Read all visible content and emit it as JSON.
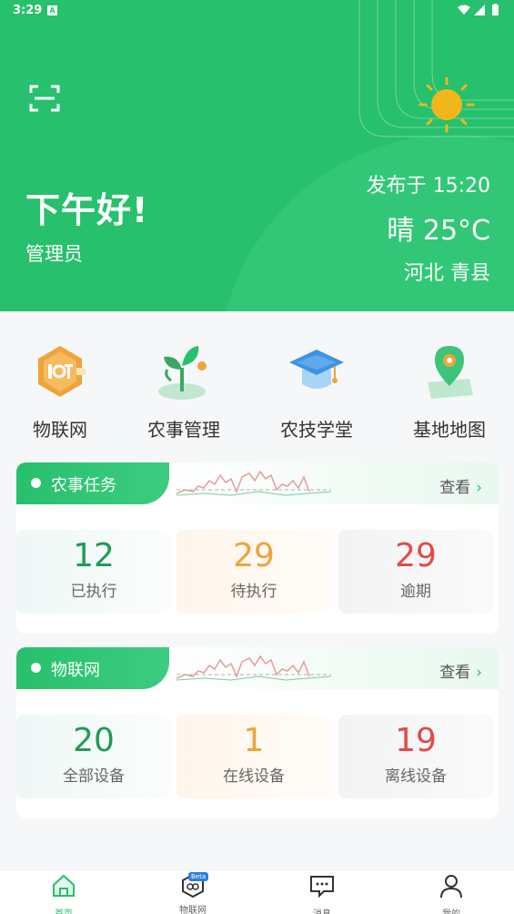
{
  "status_bar": {
    "time": "3:29",
    "badge": "A"
  },
  "header": {
    "greeting": "下午好!",
    "role": "管理员",
    "publish_time": "发布于 15:20",
    "weather": "晴 25°C",
    "location": "河北 青县",
    "colors": {
      "primary": "#27c06c",
      "sun": "#f2b61c"
    }
  },
  "quick_menu": [
    {
      "label": "物联网",
      "icon": "iot-icon"
    },
    {
      "label": "农事管理",
      "icon": "sprout-icon"
    },
    {
      "label": "农技学堂",
      "icon": "graduation-cap-icon"
    },
    {
      "label": "基地地图",
      "icon": "map-pin-icon"
    }
  ],
  "farm_tasks": {
    "title": "农事任务",
    "more": "查看",
    "stats": [
      {
        "value": "12",
        "label": "已执行"
      },
      {
        "value": "29",
        "label": "待执行"
      },
      {
        "value": "29",
        "label": "逾期"
      }
    ]
  },
  "iot": {
    "title": "物联网",
    "more": "查看",
    "stats": [
      {
        "value": "20",
        "label": "全部设备"
      },
      {
        "value": "1",
        "label": "在线设备"
      },
      {
        "value": "19",
        "label": "离线设备"
      }
    ]
  },
  "bottom_nav": [
    {
      "label": "首页",
      "icon": "home-icon",
      "active": true
    },
    {
      "label": "物联网",
      "icon": "iot-beta-icon",
      "badge": "Beta"
    },
    {
      "label": "消息",
      "icon": "message-icon"
    },
    {
      "label": "我的",
      "icon": "user-icon"
    }
  ]
}
